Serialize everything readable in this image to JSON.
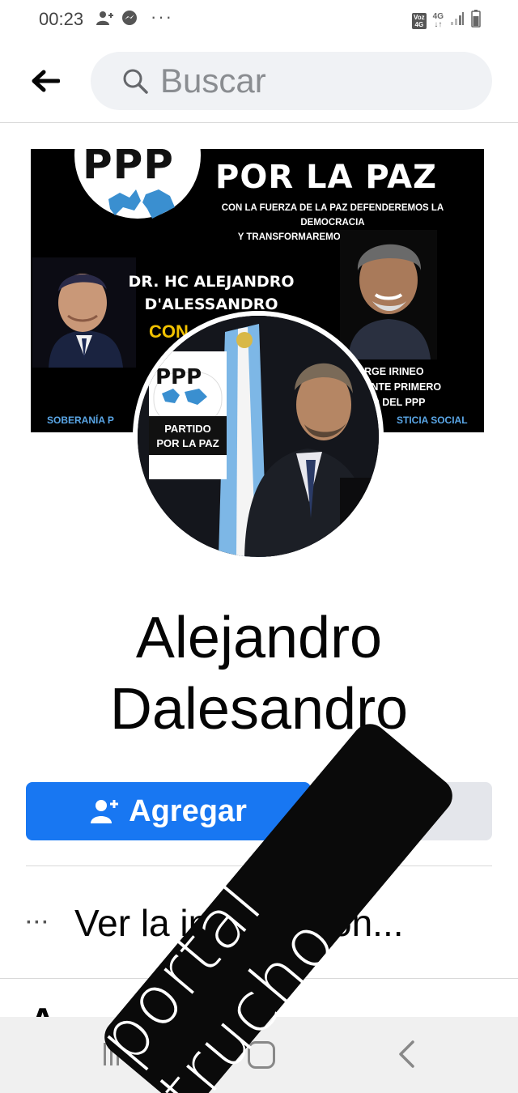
{
  "status_bar": {
    "time": "00:23",
    "dots": "···",
    "volte_label": "Voz 4G",
    "network": "4G"
  },
  "search": {
    "placeholder": "Buscar"
  },
  "cover": {
    "logo_text": "PPP",
    "title": "POR LA PAZ",
    "subtitle_line1": "CON LA FUERZA DE LA PAZ DEFENDEREMOS LA DEMOCRACIA",
    "subtitle_line2": "Y TRANSFORMAREMOS A LA ARGENTINA",
    "name_line1": "DR. HC ALEJANDRO",
    "name_line2": "D'ALESSANDRO",
    "con_text": "CON",
    "right_line1": "RGE IRINEO",
    "right_line2": "ENTE PRIMERO",
    "right_line3": "DO DEL PPP",
    "bottom_left": "SOBERANÍA P",
    "bottom_right": "STICIA SOCIAL"
  },
  "profile_pic": {
    "logo_ppp": "PPP",
    "logo_line1": "PARTIDO",
    "logo_line2": "POR LA PAZ"
  },
  "profile": {
    "name": "Alejandro Dalesandro"
  },
  "actions": {
    "add_label": "Agregar"
  },
  "info": {
    "dots": "···",
    "text": "Ver la información..."
  },
  "partial_text": "A",
  "watermark": {
    "text": "portal trucho"
  },
  "colors": {
    "accent": "#1877f2",
    "search_bg": "#f0f2f5",
    "secondary_button": "#e4e6eb"
  }
}
